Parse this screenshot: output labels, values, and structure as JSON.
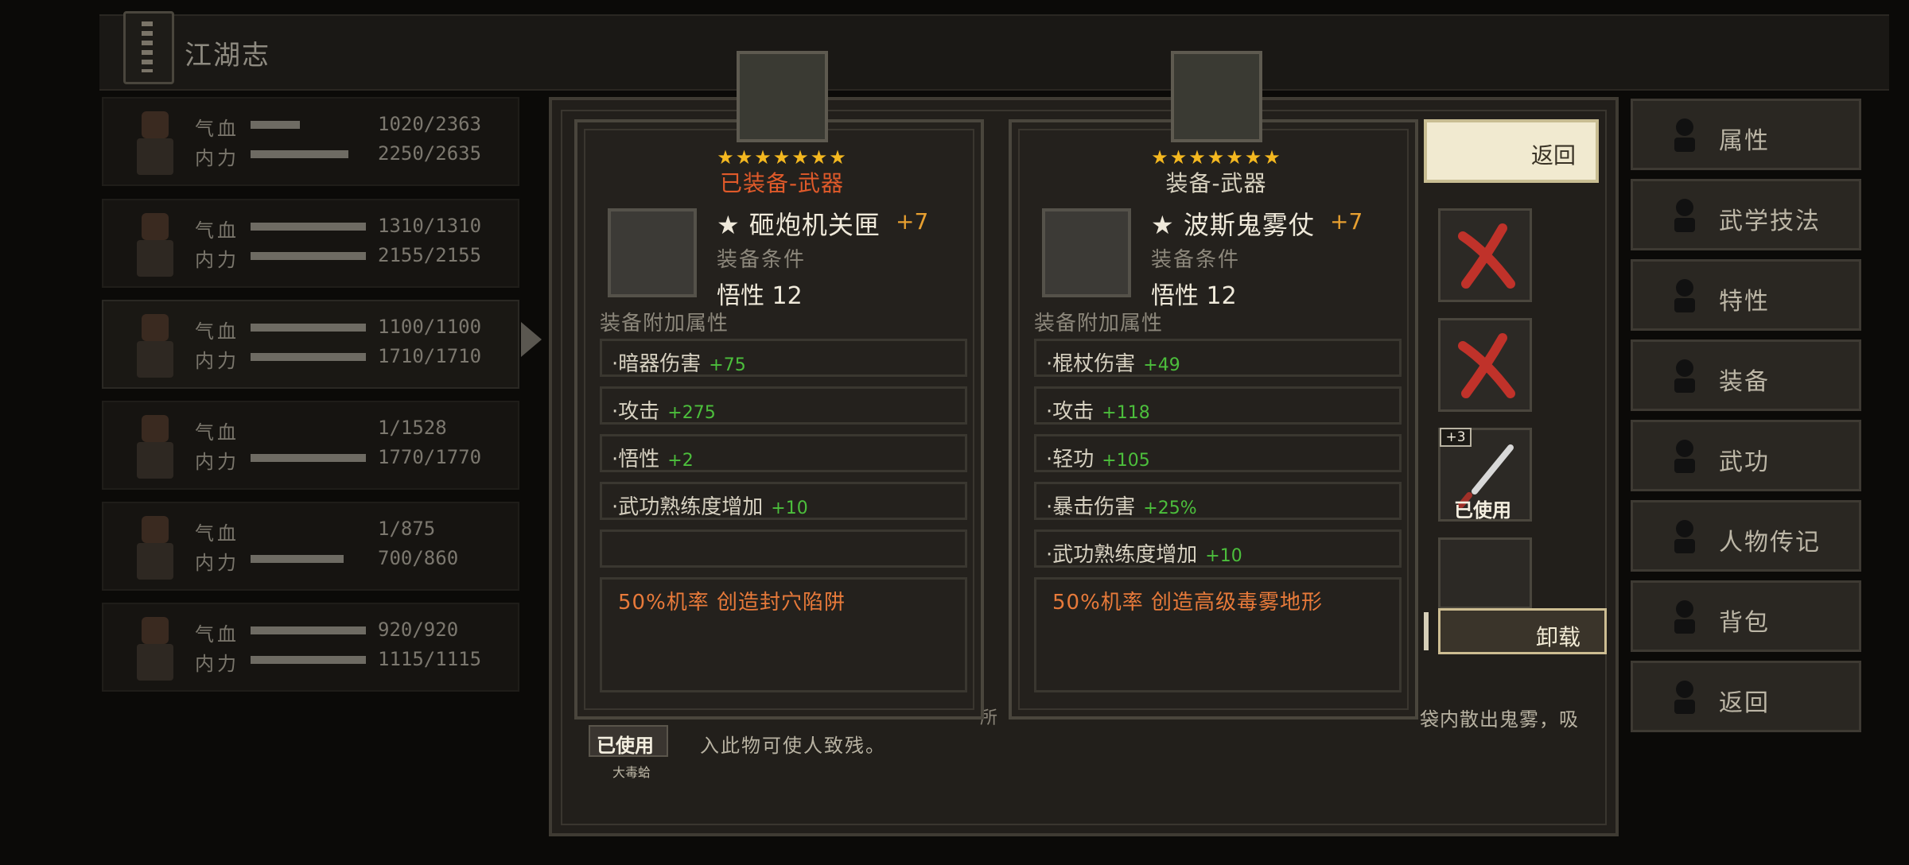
{
  "header": {
    "title": "江湖志"
  },
  "characters": [
    {
      "hp_label": "气血",
      "mp_label": "内力",
      "hp": "1020/2363",
      "mp": "2250/2635",
      "hp_frac": 0.43,
      "mp_frac": 0.85
    },
    {
      "hp_label": "气血",
      "mp_label": "内力",
      "hp": "1310/1310",
      "mp": "2155/2155",
      "hp_frac": 1.0,
      "mp_frac": 1.0
    },
    {
      "hp_label": "气血",
      "mp_label": "内力",
      "hp": "1100/1100",
      "mp": "1710/1710",
      "hp_frac": 1.0,
      "mp_frac": 1.0
    },
    {
      "hp_label": "气血",
      "mp_label": "内力",
      "hp": "1/1528",
      "mp": "1770/1770",
      "hp_frac": 0.0,
      "mp_frac": 1.0
    },
    {
      "hp_label": "气血",
      "mp_label": "内力",
      "hp": "1/875",
      "mp": "700/860",
      "hp_frac": 0.0,
      "mp_frac": 0.81
    },
    {
      "hp_label": "气血",
      "mp_label": "内力",
      "hp": "920/920",
      "mp": "1115/1115",
      "hp_frac": 1.0,
      "mp_frac": 1.0
    }
  ],
  "menu": [
    {
      "label": "属性",
      "icon": "person-icon"
    },
    {
      "label": "武学技法",
      "icon": "meditation-icon"
    },
    {
      "label": "特性",
      "icon": "trait-icon"
    },
    {
      "label": "装备",
      "icon": "sword-icon"
    },
    {
      "label": "武功",
      "icon": "manual-icon"
    },
    {
      "label": "人物传记",
      "icon": "scroll-icon"
    },
    {
      "label": "背包",
      "icon": "bag-icon"
    },
    {
      "label": "返回",
      "icon": "door-icon"
    }
  ],
  "cards": [
    {
      "stars": "★★★★★★★",
      "status": "已装备-武器",
      "status_color": "#e05a2a",
      "name": "★ 砸炮机关匣",
      "plus": "+7",
      "req_title": "装备条件",
      "req_line": "悟性  12",
      "extra_title": "装备附加属性",
      "attrs": [
        {
          "name": "·暗器伤害",
          "val": "+75"
        },
        {
          "name": "·攻击",
          "val": "+275"
        },
        {
          "name": "·悟性",
          "val": "+2"
        },
        {
          "name": "·武功熟练度增加",
          "val": "+10"
        },
        {
          "name": "",
          "val": ""
        }
      ],
      "special": "50%机率 创造封穴陷阱"
    },
    {
      "stars": "★★★★★★★",
      "status": "装备-武器",
      "status_color": "#d8d2c0",
      "name": "★ 波斯鬼雾仗",
      "plus": "+7",
      "req_title": "装备条件",
      "req_line": "悟性  12",
      "extra_title": "装备附加属性",
      "attrs": [
        {
          "name": "·棍杖伤害",
          "val": "+49"
        },
        {
          "name": "·攻击",
          "val": "+118"
        },
        {
          "name": "·轻功",
          "val": "+105"
        },
        {
          "name": "·暴击伤害",
          "val": "+25%"
        },
        {
          "name": "·武功熟练度增加",
          "val": "+10"
        }
      ],
      "special": "50%机率 创造高级毒雾地形"
    }
  ],
  "side": {
    "back_label": "返回",
    "plus_badge": "+3",
    "used_label": "已使用",
    "unequip_label": "卸载"
  },
  "desc": {
    "used_badge": "已使用",
    "used_caption": "大毒蛤",
    "text": "入此物可使人致残。",
    "fragment": "所",
    "tail": "袋内散出鬼雾，吸"
  },
  "colors": {
    "star": "#f4b820",
    "green_value": "#4cbf3c",
    "special": "#e87a3a",
    "plus": "#e8a030"
  }
}
